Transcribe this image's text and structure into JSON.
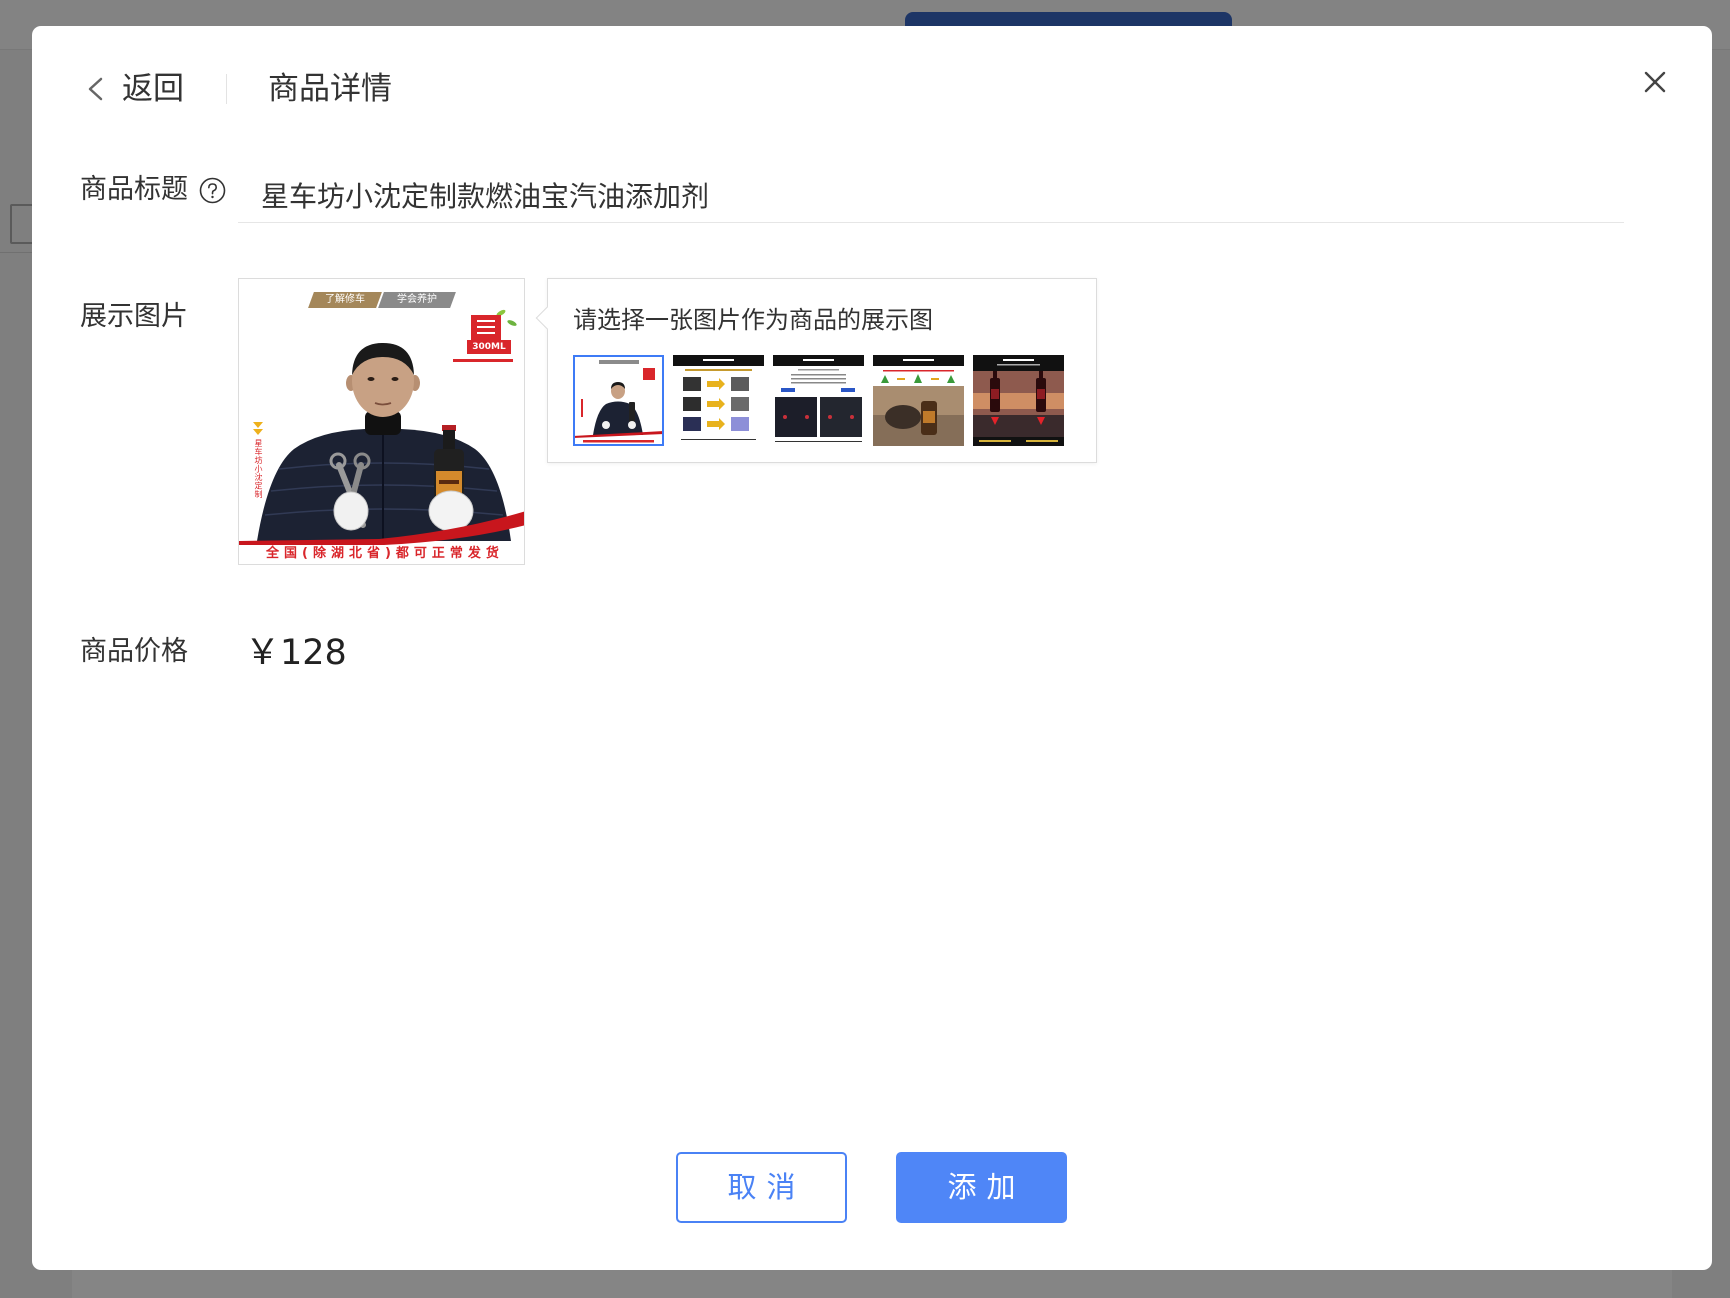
{
  "header": {
    "back_label": "返回",
    "title": "商品详情"
  },
  "form": {
    "title_label": "商品标题",
    "title_value": "星车坊小沈定制款燃油宝汽油添加剂",
    "image_label": "展示图片",
    "image_hint": "请选择一张图片作为商品的展示图",
    "price_label": "商品价格",
    "price_value": "￥128"
  },
  "product_image": {
    "tag_left": "了解修车",
    "tag_right": "学会养护",
    "badge_volume": "300ML",
    "side_text": "星车坊小沈定制",
    "footer_text": "全国(除湖北省)都可正常发货"
  },
  "gallery": {
    "selected_thumbnail": 1
  },
  "buttons": {
    "cancel": "取消",
    "add": "添加"
  },
  "icons": {
    "back": "chevron-left-icon",
    "close": "close-icon",
    "help": "question-circle-icon"
  },
  "colors": {
    "primary": "#4a82f5",
    "overlay": "#7f7f7f",
    "text": "#333333",
    "promo_red": "#d9262b"
  }
}
